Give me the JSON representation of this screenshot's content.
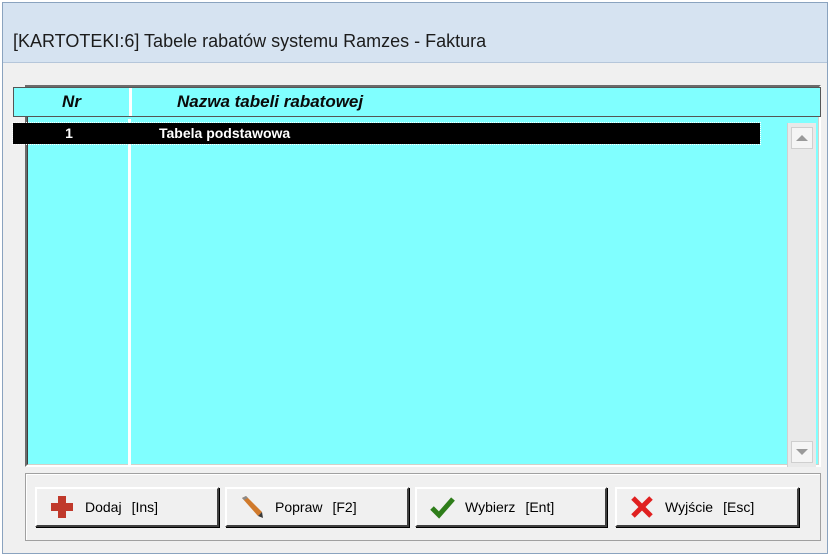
{
  "window": {
    "title": "[KARTOTEKI:6]  Tabele rabatów systemu Ramzes - Faktura"
  },
  "table": {
    "columns": [
      {
        "label": "Nr"
      },
      {
        "label": "Nazwa tabeli rabatowej"
      }
    ],
    "rows": [
      {
        "nr": "1",
        "name": "Tabela podstawowa",
        "selected": true
      }
    ],
    "background_color": "#80ffff",
    "selection_color": "#000000"
  },
  "buttons": {
    "add": {
      "label": "Dodaj",
      "key": "[Ins]",
      "icon": "plus-icon",
      "color": "#c0392b"
    },
    "edit": {
      "label": "Popraw",
      "key": "[F2]",
      "icon": "pencil-icon"
    },
    "select": {
      "label": "Wybierz",
      "key": "[Ent]",
      "icon": "checkmark-icon",
      "color": "#2e7d1a"
    },
    "exit": {
      "label": "Wyjście",
      "key": "[Esc]",
      "icon": "close-icon",
      "color": "#e02020"
    }
  }
}
